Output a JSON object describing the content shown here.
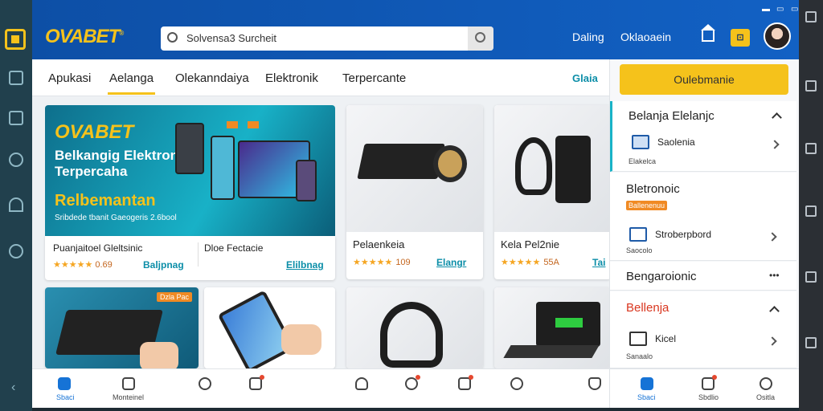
{
  "app": {
    "brand": "OVABET"
  },
  "search": {
    "placeholder": "Solvensa3 Surcheit"
  },
  "header": {
    "link1": "Daling",
    "link2": "Oklaoaein"
  },
  "tabs": [
    {
      "label": "Apukasi"
    },
    {
      "label": "Aelanga"
    },
    {
      "label": "Olekanndaiya"
    },
    {
      "label": "Elektronik"
    },
    {
      "label": "Terpercante"
    }
  ],
  "tab_more": "Glaia",
  "hero": {
    "brand": "OVABET",
    "headline": "Belkangig Elektronik Terpercaha",
    "sub": "Relbemantan",
    "small": "Sribdede tbanit Gaeogeris 2.6bool"
  },
  "hero_product": {
    "left_title": "Puanjaitoel Gleltsinic",
    "left_rating": "★★★★★",
    "left_price": "0.69",
    "left_buy": "Baljpnag",
    "right_title": "Dloe Fectacie",
    "right_buy": "Elilbnag"
  },
  "products": [
    {
      "title": "Pelaenkeia",
      "rating": "★★★★★",
      "price": "109",
      "buy": "Elangr"
    },
    {
      "title": "Kela Pel2nie",
      "rating": "★★★★★",
      "price": "55A",
      "buy": "Tai"
    }
  ],
  "row2_badge": "Dzla Pac",
  "right_panel": {
    "cta": "Oulebmanie",
    "section1": {
      "title": "Belanja Elelanjc",
      "item": "Saolenia",
      "sub": "Elakelca"
    },
    "section2": {
      "title": "Bletronoic",
      "badge": "Ballenenuu",
      "item": "Stroberpbord",
      "sub": "Saocolo"
    },
    "section3": {
      "title": "Bengaroionic",
      "more": "•••"
    },
    "section4": {
      "title": "Bellenja",
      "item": "Kicel",
      "sub": "Sanaalo"
    }
  },
  "bottom_nav": [
    {
      "label": "Sbaci",
      "active": true
    },
    {
      "label": "Monteinel"
    },
    {
      "label": ""
    },
    {
      "label": ""
    },
    {
      "label": ""
    },
    {
      "label": ""
    },
    {
      "label": ""
    },
    {
      "label": ""
    },
    {
      "label": ""
    }
  ],
  "right_nav": [
    {
      "label": "Sbaci"
    },
    {
      "label": "Sbdlio"
    },
    {
      "label": "Ositla"
    }
  ],
  "colors": {
    "accent": "#f5c21b",
    "header": "#0d4fa6",
    "teal": "#0c8ea8"
  }
}
